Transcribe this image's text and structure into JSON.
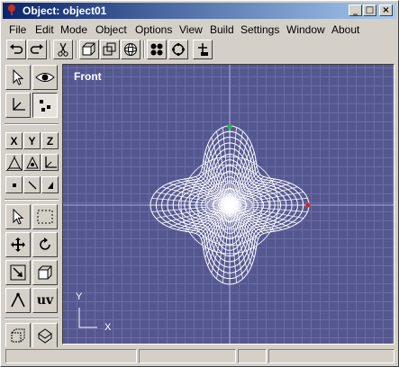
{
  "window": {
    "title": "Object: object01"
  },
  "menubar": {
    "items": [
      "File",
      "Edit",
      "Mode",
      "Object",
      "Options",
      "View",
      "Build",
      "Settings",
      "Window",
      "About"
    ]
  },
  "viewport": {
    "view_label": "Front",
    "axis_y": "Y",
    "axis_x": "X"
  },
  "left_panel": {
    "x": "X",
    "y": "Y",
    "z": "Z",
    "uv": "uv"
  },
  "colors": {
    "viewport_bg": "#55578f",
    "grid": "#6a6ca8",
    "mesh": "#ffffff",
    "title_start": "#0a246a",
    "title_end": "#a6caf0"
  }
}
